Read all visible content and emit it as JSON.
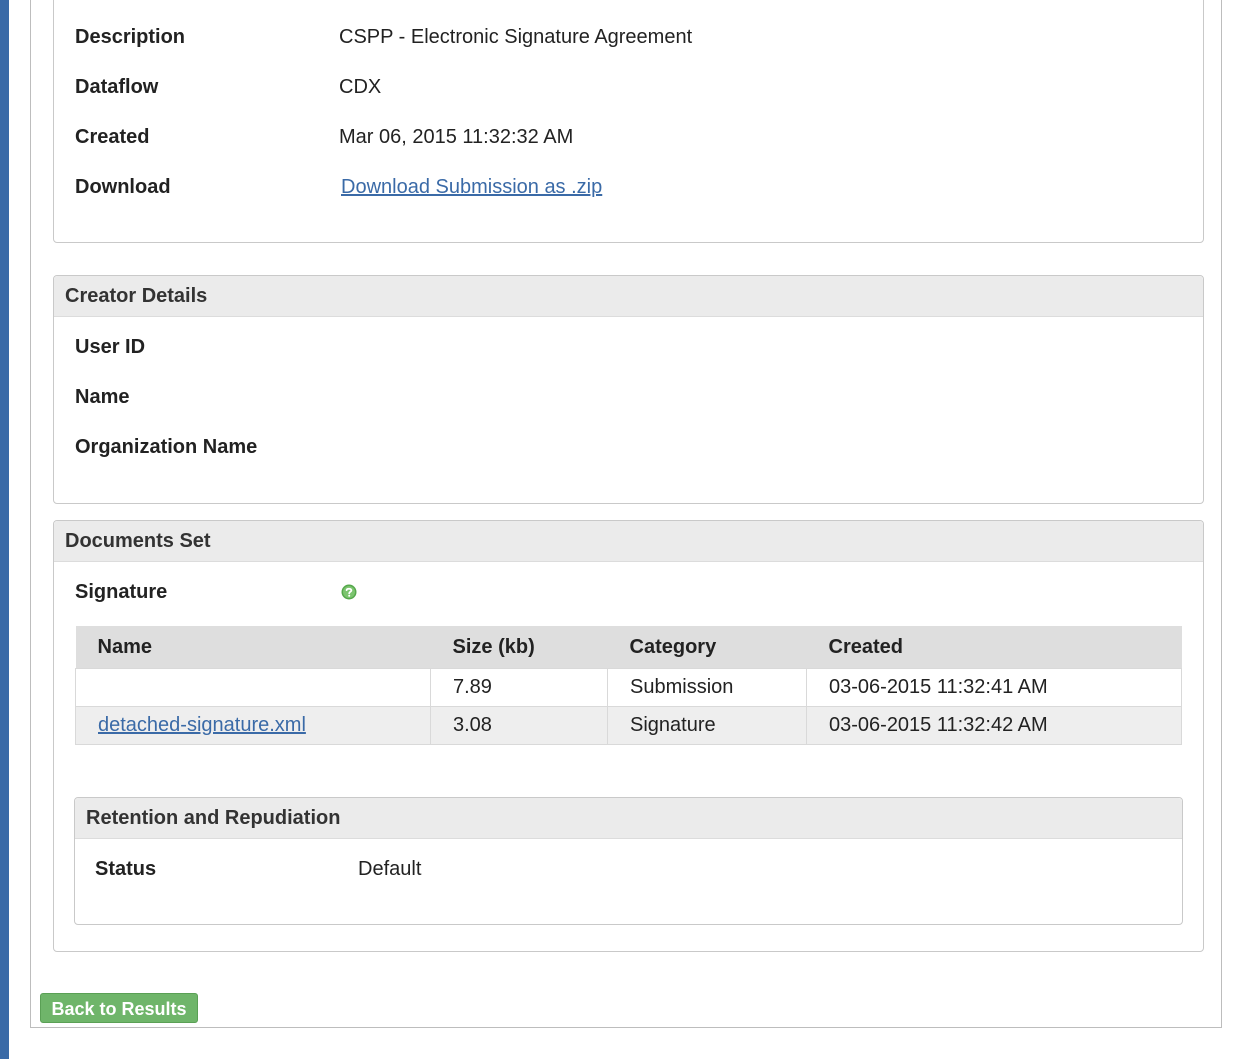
{
  "submission": {
    "fields": [
      {
        "label": "Description",
        "value": "CSPP - Electronic Signature Agreement"
      },
      {
        "label": "Dataflow",
        "value": "CDX"
      },
      {
        "label": "Created",
        "value": "Mar 06, 2015 11:32:32 AM"
      },
      {
        "label": "Download",
        "link": "Download Submission as .zip"
      }
    ]
  },
  "creator": {
    "title": "Creator Details",
    "fields": [
      {
        "label": "User ID",
        "value": ""
      },
      {
        "label": "Name",
        "value": ""
      },
      {
        "label": "Organization Name",
        "value": ""
      }
    ]
  },
  "documents": {
    "title": "Documents Set",
    "signature_label": "Signature",
    "help_icon": "help-icon",
    "columns": [
      "Name",
      "Size (kb)",
      "Category",
      "Created"
    ],
    "rows": [
      {
        "name": "",
        "size": "7.89",
        "category": "Submission",
        "created": "03-06-2015 11:32:41 AM"
      },
      {
        "name": "detached-signature.xml",
        "size": "3.08",
        "category": "Signature",
        "created": "03-06-2015 11:32:42 AM"
      }
    ],
    "retention": {
      "title": "Retention and Repudiation",
      "status_label": "Status",
      "status_value": "Default"
    }
  },
  "actions": {
    "back_label": "Back to Results"
  },
  "colors": {
    "accent_bar": "#3a6aa7",
    "link": "#3a6aa7",
    "button_green": "#6fb56a"
  }
}
